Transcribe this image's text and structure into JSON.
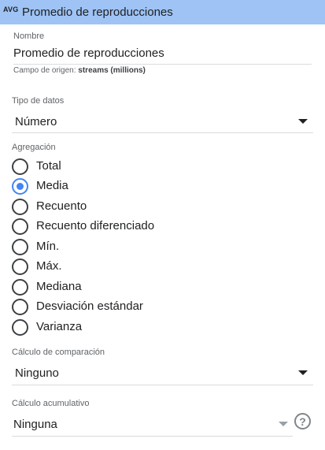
{
  "header": {
    "badge": "AVG",
    "title": "Promedio de reproducciones"
  },
  "name_field": {
    "label": "Nombre",
    "value": "Promedio de reproducciones",
    "origin_prefix": "Campo de origen:",
    "origin_value": "streams (millions)"
  },
  "data_type": {
    "label": "Tipo de datos",
    "value": "Número"
  },
  "aggregation": {
    "label": "Agregación",
    "selected": "Media",
    "options": [
      "Total",
      "Media",
      "Recuento",
      "Recuento diferenciado",
      "Mín.",
      "Máx.",
      "Mediana",
      "Desviación estándar",
      "Varianza"
    ]
  },
  "comparison": {
    "label": "Cálculo de comparación",
    "value": "Ninguno"
  },
  "cumulative": {
    "label": "Cálculo acumulativo",
    "value": "Ninguna"
  },
  "icons": {
    "help": "help-circle-icon",
    "dropdown": "chevron-down-icon"
  },
  "colors": {
    "header_bg": "#9ec3f4",
    "accent": "#4285f4"
  }
}
